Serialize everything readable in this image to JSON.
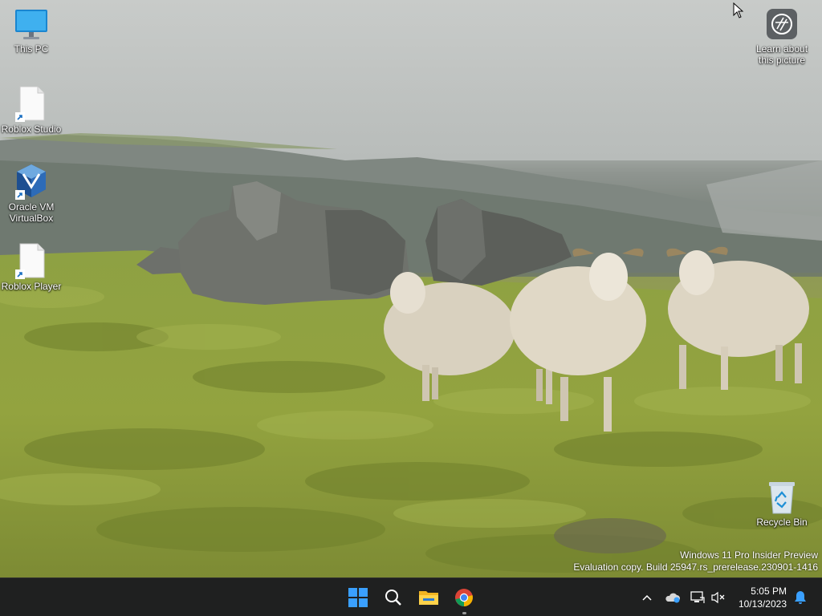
{
  "desktop_icons": [
    {
      "label": "This PC",
      "icon": "monitor-icon"
    },
    {
      "label": "Roblox Studio",
      "icon": "file-shortcut-icon"
    },
    {
      "label": "Oracle VM VirtualBox",
      "icon": "virtualbox-icon"
    },
    {
      "label": "Roblox Player",
      "icon": "file-shortcut-icon"
    },
    {
      "label": "Learn about this picture",
      "icon": "camera-icon"
    },
    {
      "label": "Recycle Bin",
      "icon": "recycle-bin-icon"
    }
  ],
  "watermark": {
    "line1": "Windows 11 Pro Insider Preview",
    "line2": "Evaluation copy. Build 25947.rs_prerelease.230901-1416"
  },
  "taskbar": {
    "apps": [
      {
        "name": "Start",
        "icon": "windows-logo-icon"
      },
      {
        "name": "Search",
        "icon": "search-icon"
      },
      {
        "name": "File Explorer",
        "icon": "folder-icon"
      },
      {
        "name": "Google Chrome",
        "icon": "chrome-icon",
        "running": true
      }
    ],
    "tray": {
      "chevron": "chevron-up-icon",
      "icons": [
        "onedrive-icon",
        "network-icon",
        "volume-muted-icon",
        "notification-bell-icon"
      ]
    },
    "clock": {
      "time": "5:05 PM",
      "date": "10/13/2023"
    }
  },
  "colors": {
    "taskbar_bg": "#1f2020",
    "accent": "#0078d4",
    "bell": "#3aa0ff"
  }
}
